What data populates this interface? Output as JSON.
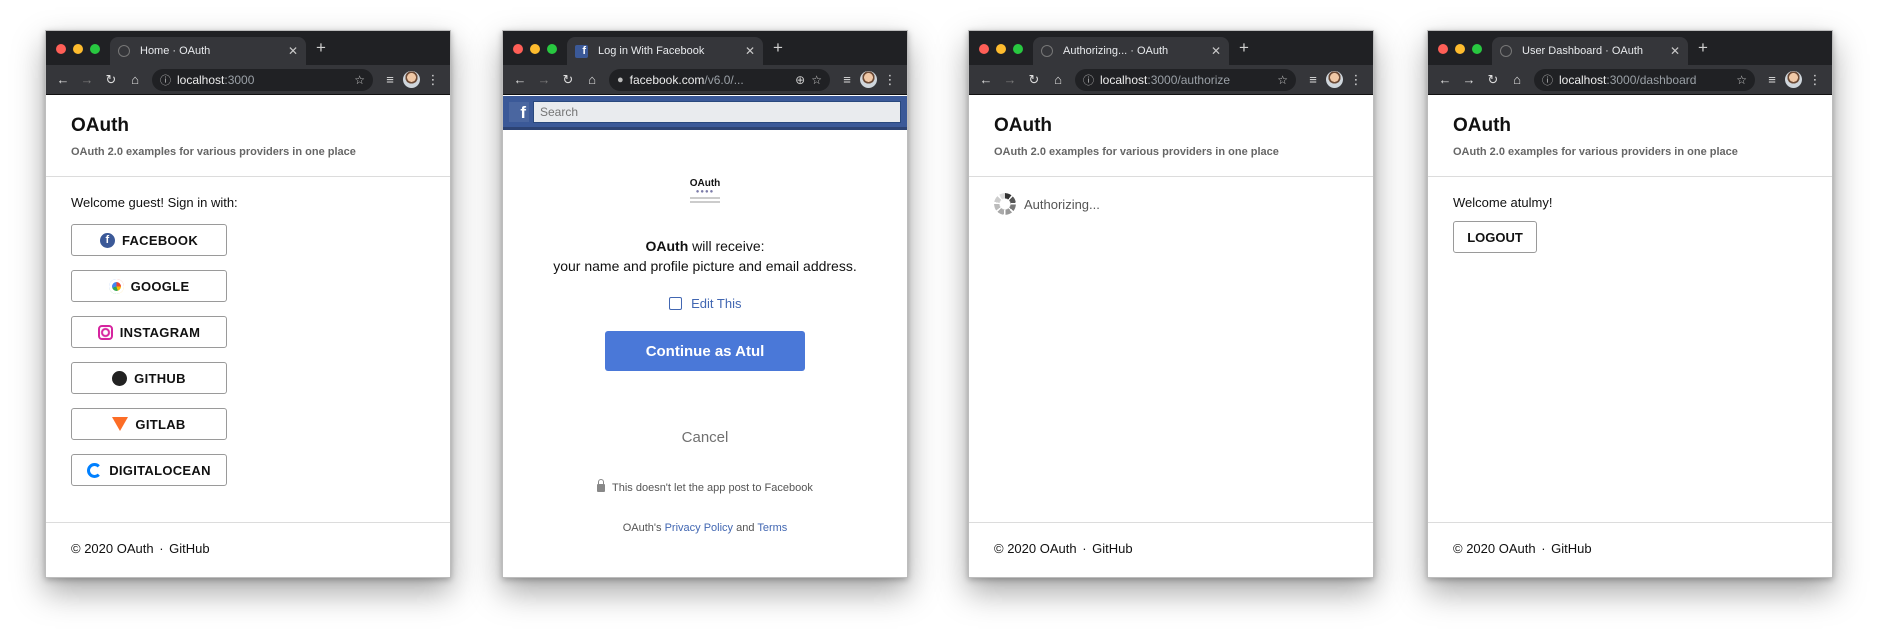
{
  "windows": [
    {
      "tab_title": "Home · OAuth",
      "url_host": "localhost",
      "url_path": ":3000",
      "brand": "OAuth",
      "tagline": "OAuth 2.0 examples for various providers in one place",
      "welcome": "Welcome guest! Sign in with:",
      "providers": [
        "FACEBOOK",
        "GOOGLE",
        "INSTAGRAM",
        "GITHUB",
        "GITLAB",
        "DIGITALOCEAN"
      ],
      "footer_copy": "© 2020 OAuth",
      "footer_sep": "·",
      "footer_link": "GitHub"
    },
    {
      "tab_title": "Log in With Facebook",
      "url_host": "facebook.com",
      "url_path": "/v6.0/...",
      "search_placeholder": "Search",
      "app_logo_title": "OAuth",
      "app_name": "OAuth",
      "will_receive": "will receive:",
      "permissions": "your name and profile picture and email address.",
      "edit_label": "Edit This",
      "continue_label": "Continue as Atul",
      "cancel_label": "Cancel",
      "no_post_note": "This doesn't let the app post to Facebook",
      "legal_prefix": "OAuth's",
      "privacy_link": "Privacy Policy",
      "legal_and": "and",
      "terms_link": "Terms"
    },
    {
      "tab_title": "Authorizing... · OAuth",
      "url_host": "localhost",
      "url_path": ":3000/authorize",
      "brand": "OAuth",
      "tagline": "OAuth 2.0 examples for various providers in one place",
      "status": "Authorizing...",
      "footer_copy": "© 2020 OAuth",
      "footer_sep": "·",
      "footer_link": "GitHub"
    },
    {
      "tab_title": "User Dashboard · OAuth",
      "url_host": "localhost",
      "url_path": ":3000/dashboard",
      "brand": "OAuth",
      "tagline": "OAuth 2.0 examples for various providers in one place",
      "welcome": "Welcome atulmy!",
      "logout_label": "LOGOUT",
      "footer_copy": "© 2020 OAuth",
      "footer_sep": "·",
      "footer_link": "GitHub"
    }
  ],
  "icons": {
    "providers": [
      "facebook-icon",
      "google-icon",
      "instagram-icon",
      "github-icon",
      "gitlab-icon",
      "digitalocean-icon"
    ]
  },
  "colors": {
    "facebook_blue": "#3b5998",
    "continue_button": "#4a78d8",
    "browser_chrome": "#202124"
  }
}
